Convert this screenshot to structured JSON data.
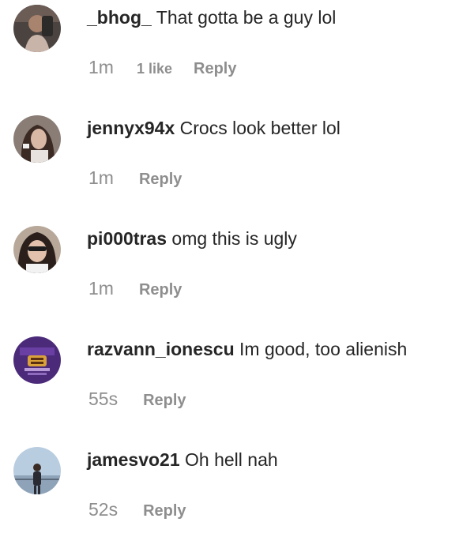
{
  "comments": [
    {
      "username": "_bhog_",
      "text": "That gotta be a guy lol",
      "time": "1m",
      "likes": "1 like",
      "reply_label": "Reply",
      "avatar_icon": "user-avatar-1"
    },
    {
      "username": "jennyx94x",
      "text": "Crocs look better lol",
      "time": "1m",
      "likes": "",
      "reply_label": "Reply",
      "avatar_icon": "user-avatar-2"
    },
    {
      "username": "pi000tras",
      "text": "omg this is ugly",
      "time": "1m",
      "likes": "",
      "reply_label": "Reply",
      "avatar_icon": "user-avatar-3"
    },
    {
      "username": "razvann_ionescu",
      "text": "Im good, too alienish",
      "time": "55s",
      "likes": "",
      "reply_label": "Reply",
      "avatar_icon": "user-avatar-4"
    },
    {
      "username": "jamesvo21",
      "text": "Oh hell nah",
      "time": "52s",
      "likes": "",
      "reply_label": "Reply",
      "avatar_icon": "user-avatar-5"
    }
  ]
}
